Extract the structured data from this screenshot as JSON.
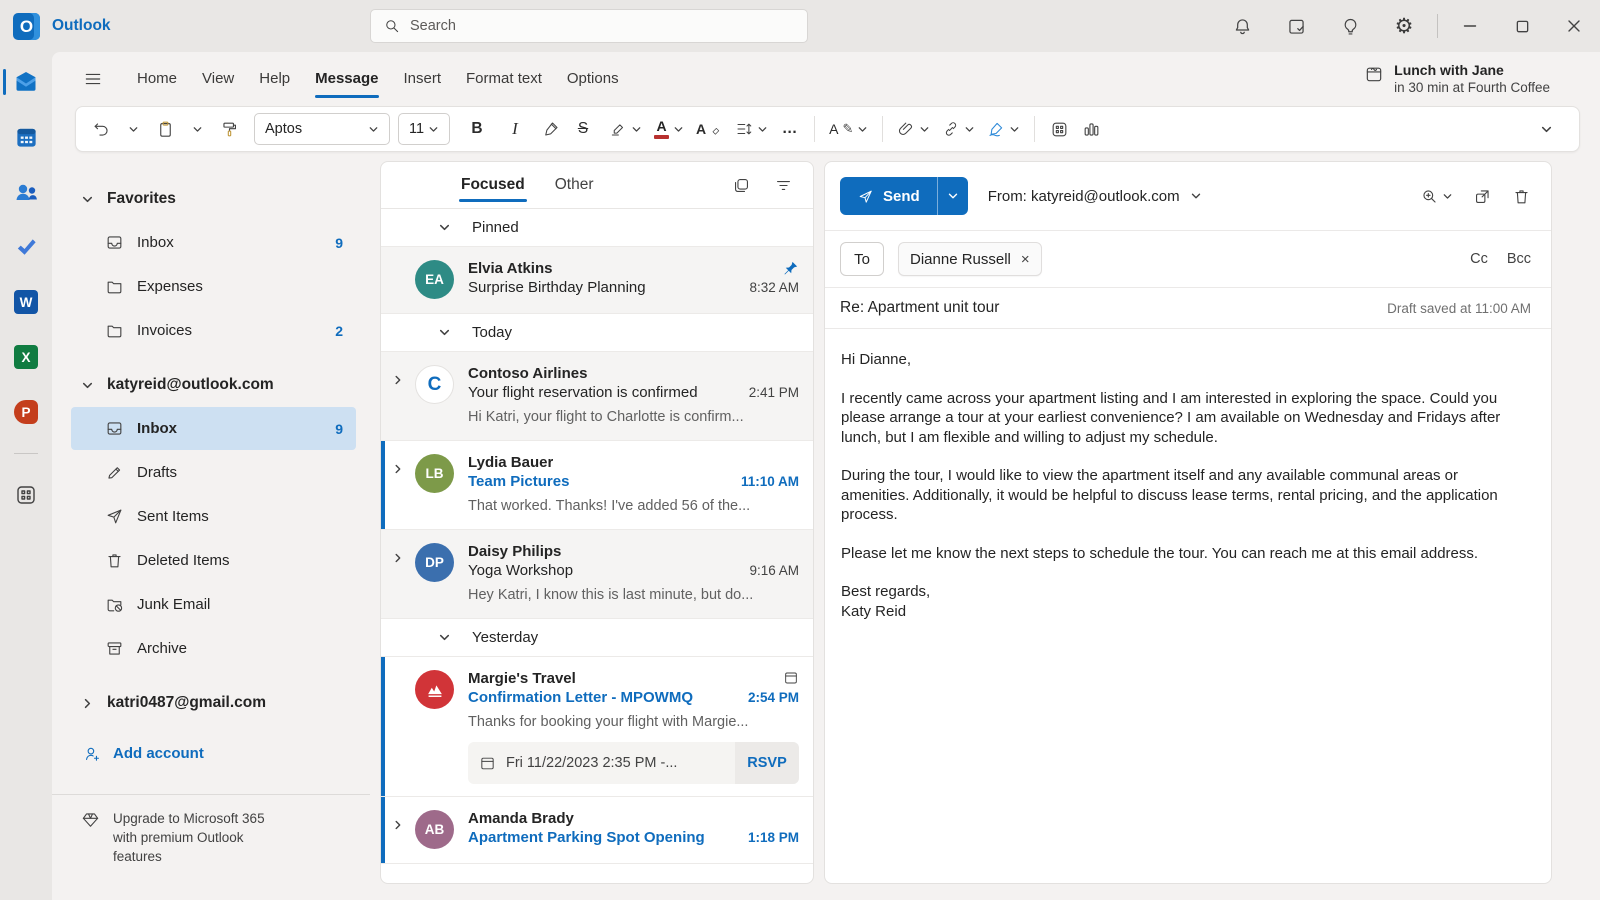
{
  "titlebar": {
    "brand": "Outlook",
    "logo_letter": "O",
    "search_placeholder": "Search"
  },
  "menubar": {
    "tabs": [
      "Home",
      "View",
      "Help",
      "Message",
      "Insert",
      "Format text",
      "Options"
    ],
    "active_tab": "Message",
    "reminder_title": "Lunch with Jane",
    "reminder_subtitle": "in 30 min at Fourth Coffee"
  },
  "toolbar": {
    "font_name": "Aptos",
    "font_size": "11",
    "bold_label": "B",
    "italic_label": "I",
    "strikethrough_label": "S",
    "font_color_letter": "A",
    "clear_format_letter": "A",
    "styles_letter": "A",
    "more_label": "…"
  },
  "sidebar": {
    "favorites_label": "Favorites",
    "favorites": [
      {
        "label": "Inbox",
        "count": "9"
      },
      {
        "label": "Expenses",
        "count": ""
      },
      {
        "label": "Invoices",
        "count": "2"
      }
    ],
    "account1_label": "katyreid@outlook.com",
    "account1_items": [
      {
        "label": "Inbox",
        "count": "9"
      },
      {
        "label": "Drafts",
        "count": ""
      },
      {
        "label": "Sent Items",
        "count": ""
      },
      {
        "label": "Deleted Items",
        "count": ""
      },
      {
        "label": "Junk Email",
        "count": ""
      },
      {
        "label": "Archive",
        "count": ""
      }
    ],
    "account2_label": "katri0487@gmail.com",
    "add_account_label": "Add account",
    "upgrade_text": "Upgrade to Microsoft 365 with premium Outlook features"
  },
  "list": {
    "tab_focused": "Focused",
    "tab_other": "Other",
    "groups": [
      {
        "label": "Pinned"
      },
      {
        "label": "Today"
      },
      {
        "label": "Yesterday"
      }
    ],
    "messages": [
      {
        "sender": "Elvia Atkins",
        "initials": "EA",
        "subject": "Surprise Birthday Planning",
        "time": "8:32 AM",
        "preview": ""
      },
      {
        "sender": "Contoso Airlines",
        "logo_letter": "C",
        "subject": "Your flight reservation is confirmed",
        "time": "2:41 PM",
        "preview": "Hi Katri, your flight to Charlotte is confirm..."
      },
      {
        "sender": "Lydia Bauer",
        "initials": "LB",
        "subject": "Team Pictures",
        "time": "11:10 AM",
        "preview": "That worked. Thanks! I've added 56 of the..."
      },
      {
        "sender": "Daisy Philips",
        "initials": "DP",
        "subject": "Yoga Workshop",
        "time": "9:16 AM",
        "preview": "Hey Katri, I know this is last minute, but do..."
      },
      {
        "sender": "Margie's Travel",
        "subject": "Confirmation Letter - MPOWMQ",
        "time": "2:54 PM",
        "preview": "Thanks for booking your flight with Margie...",
        "meeting_text": "Fri 11/22/2023 2:35 PM -...",
        "rsvp_label": "RSVP"
      },
      {
        "sender": "Amanda Brady",
        "initials": "AB",
        "subject": "Apartment Parking Spot Opening",
        "time": "1:18 PM",
        "preview": ""
      }
    ]
  },
  "compose": {
    "send_label": "Send",
    "from_line": "From: katyreid@outlook.com",
    "to_label": "To",
    "recipient": "Dianne Russell",
    "remove_recipient": "×",
    "cc_label": "Cc",
    "bcc_label": "Bcc",
    "subject": "Re: Apartment unit tour",
    "draft_status": "Draft saved at 11:00 AM",
    "body": [
      "Hi Dianne,",
      "I recently came across your apartment listing and I am interested in exploring the space. Could you please arrange a tour at your earliest convenience? I am available on Wednesday and Fridays after lunch, but I am flexible and willing to adjust my schedule.",
      "During the tour, I would like to view the apartment itself and any available communal areas or amenities. Additionally, it would be helpful to discuss lease terms, rental pricing, and the application process.",
      "Please let me know the next steps to schedule the tour. You can reach me at this email address.",
      "Best regards,",
      "Katy Reid"
    ]
  },
  "icons": {
    "titlebar": [
      "search-icon",
      "notifications-bell-icon",
      "my-day-checklist-icon",
      "tips-lightbulb-icon",
      "settings-gear-icon",
      "minimize-icon",
      "maximize-icon",
      "close-icon"
    ],
    "rail": [
      "mail-icon",
      "calendar-icon",
      "people-icon",
      "todo-check-icon",
      "word-icon",
      "excel-icon",
      "powerpoint-icon",
      "more-apps-grid-icon"
    ],
    "toolbar": [
      "undo-icon",
      "paste-clipboard-icon",
      "format-painter-icon",
      "pen-icon",
      "highlight-icon",
      "font-color-icon",
      "clear-format-icon",
      "line-spacing-icon",
      "styles-icon",
      "attach-paperclip-icon",
      "link-icon",
      "signature-pen-icon",
      "apps-grid-icon",
      "chart-icon",
      "expand-chevron-icon"
    ],
    "list": [
      "select-messages-icon",
      "filter-icon",
      "pin-icon",
      "calendar-event-icon"
    ],
    "compose": [
      "send-plane-icon",
      "zoom-in-icon",
      "open-new-window-icon",
      "delete-trash-icon"
    ]
  },
  "colors": {
    "accent": "#0f6cbd",
    "brand_blue": "#0f6cbd",
    "selected_folder_bg": "#cde0f2",
    "unread_blue": "#0f6cbd",
    "read_row_bg": "#f5f4f3",
    "margies_logo_red": "#d13438",
    "excel_green": "#107c41",
    "powerpoint_orange": "#c43e1c",
    "word_blue": "#1255a6"
  }
}
